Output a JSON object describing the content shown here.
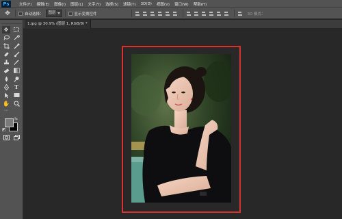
{
  "app": {
    "logo": "Ps"
  },
  "menu": [
    {
      "label": "文件(F)"
    },
    {
      "label": "编辑(E)"
    },
    {
      "label": "图像(I)"
    },
    {
      "label": "图层(L)"
    },
    {
      "label": "文字(Y)"
    },
    {
      "label": "选择(S)"
    },
    {
      "label": "滤镜(T)"
    },
    {
      "label": "3D(D)"
    },
    {
      "label": "视图(V)"
    },
    {
      "label": "窗口(W)"
    },
    {
      "label": "帮助(H)"
    }
  ],
  "options": {
    "auto_select_label": "自动选择：",
    "auto_select_value": "图层",
    "show_transform_label": "显示变换控件",
    "mode_3d_label": "3D 模式："
  },
  "document": {
    "tab_title": "1.jpg @ 30.9% (图层 1, RGB/8) *"
  },
  "tools": [
    {
      "icon": "move-icon"
    },
    {
      "icon": "marquee-icon"
    },
    {
      "icon": "lasso-icon"
    },
    {
      "icon": "quick-select-icon"
    },
    {
      "icon": "crop-icon"
    },
    {
      "icon": "eyedropper-icon"
    },
    {
      "icon": "healing-icon"
    },
    {
      "icon": "brush-icon"
    },
    {
      "icon": "stamp-icon"
    },
    {
      "icon": "history-brush-icon"
    },
    {
      "icon": "eraser-icon"
    },
    {
      "icon": "gradient-icon"
    },
    {
      "icon": "blur-icon"
    },
    {
      "icon": "dodge-icon"
    },
    {
      "icon": "pen-icon"
    },
    {
      "icon": "type-icon"
    },
    {
      "icon": "path-select-icon"
    },
    {
      "icon": "rectangle-icon"
    },
    {
      "icon": "hand-icon"
    },
    {
      "icon": "zoom-icon"
    }
  ],
  "colors": {
    "foreground": "#7a7a7a",
    "background": "#000000",
    "selection_border": "#d9322d"
  }
}
